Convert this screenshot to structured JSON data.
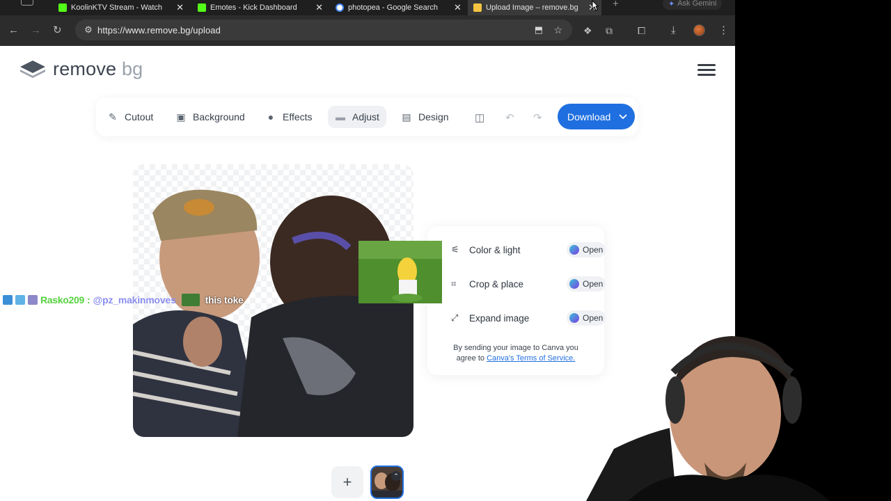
{
  "browser": {
    "tabs": [
      {
        "title": "KoolinKTV Stream - Watch",
        "favicon_color": "#53fc18"
      },
      {
        "title": "Emotes - Kick Dashboard",
        "favicon_color": "#53fc18"
      },
      {
        "title": "photopea - Google Search",
        "favicon_color": "#4285f4"
      },
      {
        "title": "Upload Image – remove.bg",
        "favicon_color": "#f5c542",
        "active": true
      }
    ],
    "new_tab_label": "+",
    "ask_gemini_label": "Ask Gemini",
    "url": "https://www.remove.bg/upload"
  },
  "site": {
    "logo": {
      "bold": "remove",
      "light": "bg"
    }
  },
  "editbar": {
    "cutout": "Cutout",
    "background": "Background",
    "effects": "Effects",
    "adjust": "Adjust",
    "design": "Design",
    "download": "Download",
    "active_tab": "Adjust"
  },
  "adjust_panel": {
    "items": [
      {
        "label": "Color & light",
        "action": "Open"
      },
      {
        "label": "Crop & place",
        "action": "Open"
      },
      {
        "label": "Expand image",
        "action": "Open"
      }
    ],
    "terms_prefix": "By sending your image to Canva you agree to",
    "terms_link": "Canva's Terms of Service."
  },
  "thumbs": {
    "add_label": "+"
  },
  "stream_chat": {
    "username": "Rasko209",
    "separator": ":",
    "mention": "@pz_makinmoves",
    "message": "this toke"
  },
  "colors": {
    "accent": "#1f6fe0",
    "chat_user": "#55d23e",
    "chat_mention": "#8a8ef0"
  }
}
